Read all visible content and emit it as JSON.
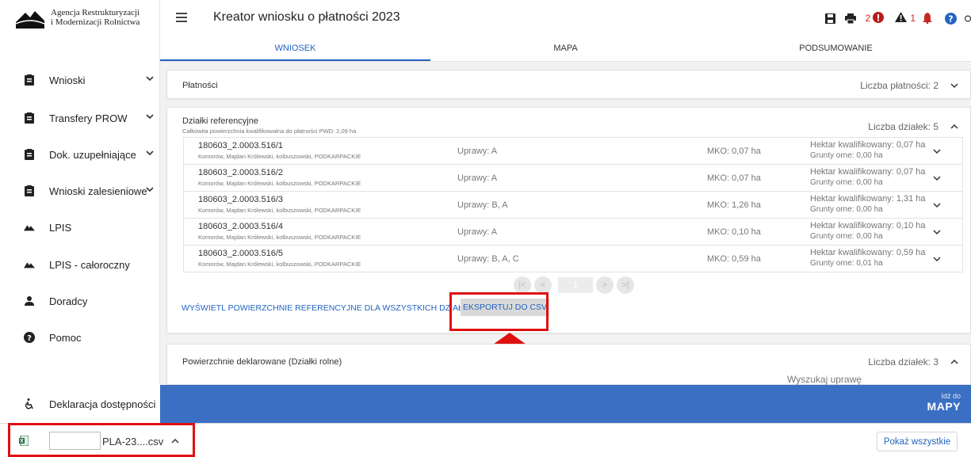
{
  "org": {
    "name_line1": "Agencja Restrukturyzacji",
    "name_line2": "i Modernizacji Rolnictwa",
    "logo_caption": "ARiMR"
  },
  "sidebar": {
    "items": [
      {
        "label": "Wnioski",
        "icon": "clipboard-icon",
        "expandable": true
      },
      {
        "label": "Transfery PROW",
        "icon": "clipboard-icon",
        "expandable": true
      },
      {
        "label": "Dok. uzupełniające",
        "icon": "clipboard-icon",
        "expandable": true
      },
      {
        "label": "Wnioski zalesieniowe",
        "icon": "clipboard-icon",
        "expandable": true
      },
      {
        "label": "LPIS",
        "icon": "terrain-icon",
        "expandable": false
      },
      {
        "label": "LPIS - całoroczny",
        "icon": "terrain-icon",
        "expandable": false
      },
      {
        "label": "Doradcy",
        "icon": "person-icon",
        "expandable": false
      },
      {
        "label": "Pomoc",
        "icon": "help-icon",
        "expandable": false
      }
    ],
    "accessibility_label": "Deklaracja dostępności"
  },
  "header": {
    "title": "Kreator wniosku o płatności 2023",
    "error_count": "2",
    "warning_count": "1"
  },
  "tabs": [
    {
      "label": "WNIOSEK",
      "active": true
    },
    {
      "label": "MAPA",
      "active": false
    },
    {
      "label": "PODSUMOWANIE",
      "active": false
    }
  ],
  "payments": {
    "title": "Płatności",
    "count_label": "Liczba płatności: 2"
  },
  "parcels": {
    "title": "Działki referencyjne",
    "subtitle": "Całkowita powierzchnia kwalifikowalna do płatności PWD: 2,09 ha",
    "count_label": "Liczba działek: 5",
    "rows": [
      {
        "id": "180603_2.0003.516/1",
        "location": "Komorów, Majdan Królewski, kolbuszowski, PODKARPACKIE",
        "crops": "Uprawy: A",
        "mko": "MKO: 0,07 ha",
        "hectare": "Hektar kwalifikowany: 0,07 ha",
        "arable": "Grunty orne: 0,00 ha"
      },
      {
        "id": "180603_2.0003.516/2",
        "location": "Komorów, Majdan Królewski, kolbuszowski, PODKARPACKIE",
        "crops": "Uprawy: A",
        "mko": "MKO: 0,07 ha",
        "hectare": "Hektar kwalifikowany: 0,07 ha",
        "arable": "Grunty orne: 0,00 ha"
      },
      {
        "id": "180603_2.0003.516/3",
        "location": "Komorów, Majdan Królewski, kolbuszowski, PODKARPACKIE",
        "crops": "Uprawy: B, A",
        "mko": "MKO: 1,26 ha",
        "hectare": "Hektar kwalifikowany: 1,31 ha",
        "arable": "Grunty orne: 0,00 ha"
      },
      {
        "id": "180603_2.0003.516/4",
        "location": "Komorów, Majdan Królewski, kolbuszowski, PODKARPACKIE",
        "crops": "Uprawy: A",
        "mko": "MKO: 0,10 ha",
        "hectare": "Hektar kwalifikowany: 0,10 ha",
        "arable": "Grunty orne: 0,00 ha"
      },
      {
        "id": "180603_2.0003.516/5",
        "location": "Komorów, Majdan Królewski, kolbuszowski, PODKARPACKIE",
        "crops": "Uprawy: B, A, C",
        "mko": "MKO: 0,59 ha",
        "hectare": "Hektar kwalifikowany: 0,59 ha",
        "arable": "Grunty orne: 0,01 ha"
      }
    ],
    "pager": {
      "first": "|<",
      "prev": "<",
      "page": "1",
      "next": ">",
      "last": ">|"
    },
    "show_all_link": "WYŚWIETL POWIERZCHNIE REFERENCYJNE DLA WSZYSTKICH DZIAŁEK",
    "export_button": "EKSPORTUJ DO CSV"
  },
  "declared": {
    "title": "Powierzchnie deklarowane (Działki rolne)",
    "count_label": "Liczba działek: 3",
    "search_label": "Wyszukaj uprawę"
  },
  "goto_map": {
    "small": "Idź do",
    "big": "MAPY"
  },
  "download_bar": {
    "file_name": "PLA-23....csv",
    "show_all": "Pokaż wszystkie"
  },
  "colors": {
    "accent": "#2364c2",
    "bluebar": "#3a6fc3",
    "highlight": "#e01010",
    "error": "#c62828"
  }
}
